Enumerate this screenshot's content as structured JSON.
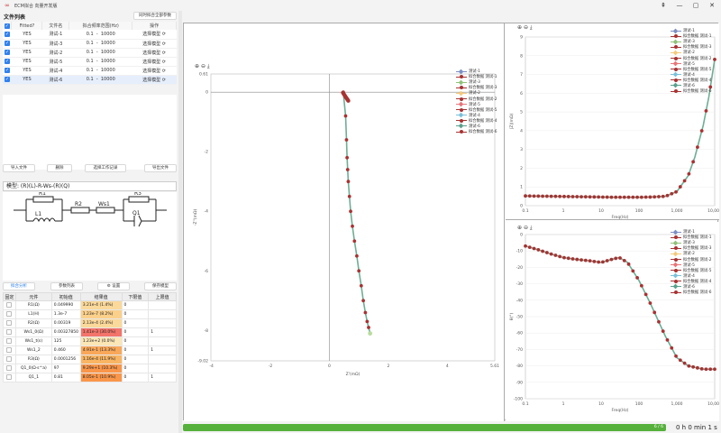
{
  "window": {
    "title": "ECM拟合 向量开发版",
    "controls": [
      "⇞",
      "—",
      "▢",
      "✕"
    ]
  },
  "files": {
    "section_title": "文件列表",
    "batch_btn": "同时拟合全部参数",
    "headers": [
      "Fitted?",
      "文件名",
      "拟合频率范围(Hz)",
      "操作"
    ],
    "rows": [
      {
        "fitted": "YES",
        "name": "测试-1",
        "fmin": "0.1",
        "dash": "-",
        "fmax": "10000",
        "op": "选择模型"
      },
      {
        "fitted": "YES",
        "name": "测试-3",
        "fmin": "0.1",
        "dash": "-",
        "fmax": "10000",
        "op": "选择模型"
      },
      {
        "fitted": "YES",
        "name": "测试-2",
        "fmin": "0.1",
        "dash": "-",
        "fmax": "10000",
        "op": "选择模型"
      },
      {
        "fitted": "YES",
        "name": "测试-5",
        "fmin": "0.1",
        "dash": "-",
        "fmax": "10000",
        "op": "选择模型"
      },
      {
        "fitted": "YES",
        "name": "测试-4",
        "fmin": "0.1",
        "dash": "-",
        "fmax": "10000",
        "op": "选择模型"
      },
      {
        "fitted": "YES",
        "name": "测试-6",
        "fmin": "0.1",
        "dash": "-",
        "fmax": "10000",
        "op": "选择模型"
      }
    ],
    "buttons": [
      "导入文件",
      "删除",
      "选择工作记录",
      "导出文件"
    ]
  },
  "model": {
    "label": "模型: (R)(L)-R-Ws-(R)(Q)",
    "elements": [
      "R1",
      "R2",
      "Ws1",
      "R3",
      "L1",
      "Q1"
    ]
  },
  "fit": {
    "buttons": [
      "拟合分析",
      "参数列表",
      "⚙ 设置",
      "保存模型"
    ],
    "headers": [
      "固定",
      "元件",
      "初始值",
      "结果值",
      "下限值",
      "上限值"
    ],
    "rows": [
      {
        "name": "R1(Ω)",
        "init": "0.049990",
        "result": "3.21e-4 (1.4%)",
        "lo": "0",
        "hi": "",
        "color": "#fbd99a"
      },
      {
        "name": "L1(H)",
        "init": "1.3e-7",
        "result": "1.23e-7 (8.2%)",
        "lo": "0",
        "hi": "",
        "color": "#fbd08a"
      },
      {
        "name": "R2(Ω)",
        "init": "0.00319",
        "result": "2.13e-4 (2.4%)",
        "lo": "0",
        "hi": "",
        "color": "#fbd99a"
      },
      {
        "name": "Ws1_0(Ω)",
        "init": "0.00327850",
        "result": "1.41e-3 (30.0%)",
        "lo": "0",
        "hi": "1",
        "color": "#f3746a"
      },
      {
        "name": "Ws1_t(s)",
        "init": "125",
        "result": "1.23e+2 (0.0%)",
        "lo": "0",
        "hi": "",
        "color": "#fbe6b5"
      },
      {
        "name": "Ws1_2",
        "init": "0.460",
        "result": "4.91e-1 (13.3%)",
        "lo": "0",
        "hi": "1",
        "color": "#f9a85a"
      },
      {
        "name": "R3(Ω)",
        "init": "0.0001256",
        "result": "1.16e-4 (11.9%)",
        "lo": "0",
        "hi": "",
        "color": "#f9b563"
      },
      {
        "name": "Q1_0(Ω·s^a)",
        "init": "97",
        "result": "9.29e+1 (10.3%)",
        "lo": "0",
        "hi": "",
        "color": "#f9964a"
      },
      {
        "name": "Q1_1",
        "init": "0.81",
        "result": "8.05e-1 (10.9%)",
        "lo": "0",
        "hi": "1",
        "color": "#f9964a"
      }
    ]
  },
  "toolbar_icons": [
    "zoom-in-icon",
    "zoom-out-icon",
    "download-icon"
  ],
  "legend": [
    {
      "label": "测试-1",
      "kind": "marker",
      "color": "#7d8fc4"
    },
    {
      "label": "拟合数据 测试-1",
      "kind": "dot",
      "color": "#a83232"
    },
    {
      "label": "测试-3",
      "kind": "marker",
      "color": "#91c27a"
    },
    {
      "label": "拟合数据 测试-3",
      "kind": "dot",
      "color": "#a83232"
    },
    {
      "label": "测试-2",
      "kind": "marker",
      "color": "#f4c97c"
    },
    {
      "label": "拟合数据 测试-2",
      "kind": "dot",
      "color": "#a83232"
    },
    {
      "label": "测试-5",
      "kind": "marker",
      "color": "#e8767a"
    },
    {
      "label": "拟合数据 测试-5",
      "kind": "dot",
      "color": "#a83232"
    },
    {
      "label": "测试-4",
      "kind": "marker",
      "color": "#7cc1d9"
    },
    {
      "label": "拟合数据 测试-4",
      "kind": "dot",
      "color": "#a83232"
    },
    {
      "label": "测试-6",
      "kind": "marker",
      "color": "#5aa18d"
    },
    {
      "label": "拟合数据 测试-6",
      "kind": "dot",
      "color": "#a83232"
    }
  ],
  "chart_data": [
    {
      "type": "scatter",
      "title": "Nyquist",
      "xlabel": "Z'(mΩ)",
      "ylabel": "-Z''(mΩ)",
      "xlim": [
        -4.02,
        5.61
      ],
      "ylim": [
        -9.02,
        0.61
      ],
      "xticks": [
        -4,
        -2,
        0,
        2,
        4
      ],
      "yticks": [
        0,
        -2,
        -4,
        -6,
        -8
      ],
      "x": [
        0.47,
        0.55,
        0.58,
        0.6,
        0.62,
        0.64,
        0.68,
        0.72,
        0.78,
        0.85,
        0.93,
        1.0,
        1.08,
        1.15,
        1.22,
        1.28,
        1.33,
        1.38
      ],
      "y": [
        0.0,
        -0.8,
        -1.6,
        -2.2,
        -2.6,
        -3.0,
        -3.5,
        -4.0,
        -4.5,
        -5.0,
        -5.5,
        -6.0,
        -6.5,
        -7.0,
        -7.4,
        -7.7,
        -7.9,
        -8.1
      ]
    },
    {
      "type": "line",
      "xlabel": "Freq(Hz)",
      "ylabel": "|Z|(mΩ)",
      "xscale": "log",
      "xlim": [
        0.1,
        10000
      ],
      "ylim": [
        0,
        9
      ],
      "xticks": [
        "0.1",
        "1",
        "10",
        "100",
        "1,000",
        "10,000"
      ],
      "yticks": [
        0,
        1,
        2,
        3,
        4,
        5,
        6,
        7,
        8,
        9
      ],
      "x": [
        0.1,
        0.2,
        0.5,
        1,
        2,
        5,
        10,
        20,
        50,
        100,
        200,
        500,
        1000,
        2000,
        3000,
        5000,
        7000,
        10000
      ],
      "y": [
        0.52,
        0.51,
        0.5,
        0.49,
        0.48,
        0.47,
        0.46,
        0.45,
        0.45,
        0.45,
        0.46,
        0.5,
        0.75,
        1.6,
        2.6,
        4.3,
        5.8,
        7.8
      ]
    },
    {
      "type": "line",
      "xlabel": "Freq(Hz)",
      "ylabel": "θ(°)",
      "xscale": "log",
      "xlim": [
        0.1,
        10000
      ],
      "ylim": [
        -100,
        0
      ],
      "xticks": [
        "0.1",
        "1",
        "10",
        "100",
        "1,000",
        "10,000"
      ],
      "yticks": [
        0,
        -10,
        -20,
        -30,
        -40,
        -50,
        -60,
        -70,
        -80,
        -90,
        -100
      ],
      "x": [
        0.1,
        0.2,
        0.5,
        1,
        2,
        5,
        10,
        20,
        30,
        50,
        100,
        200,
        500,
        1000,
        2000,
        5000,
        10000
      ],
      "y": [
        -7,
        -9,
        -12,
        -14,
        -15,
        -16,
        -17,
        -15,
        -14,
        -17,
        -28,
        -42,
        -62,
        -75,
        -80,
        -82,
        -82
      ]
    }
  ],
  "progress": {
    "label": "6 / 6",
    "fraction": 1.0
  },
  "elapsed": "0 h 0 min 1 s"
}
